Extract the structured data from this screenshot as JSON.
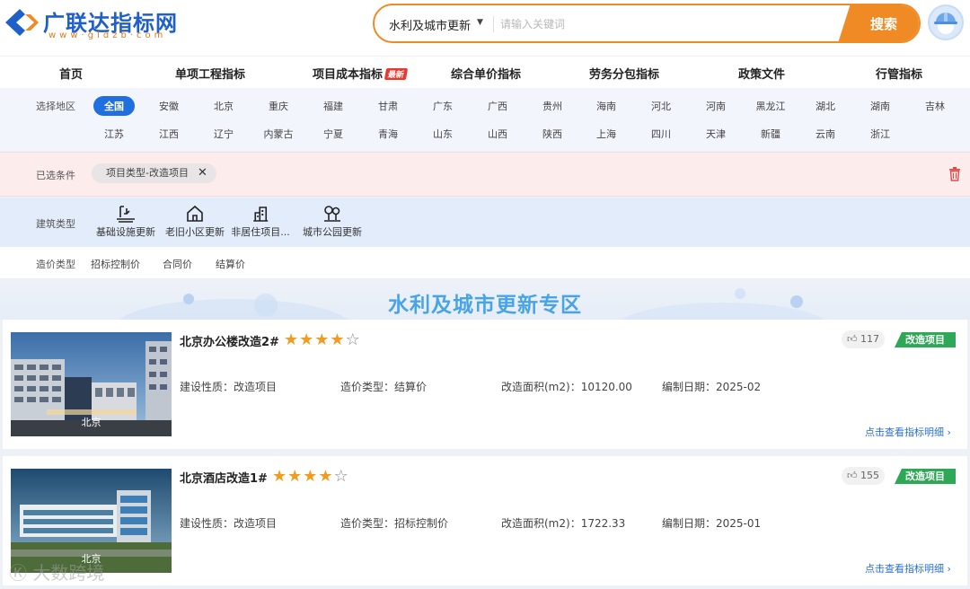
{
  "header": {
    "logo_text": "广联达指标网",
    "logo_sub": "www·gldzb·com",
    "search_category": "水利及城市更新",
    "search_placeholder": "请输入关键词",
    "search_button": "搜索"
  },
  "nav": [
    {
      "label": "首页"
    },
    {
      "label": "单项工程指标"
    },
    {
      "label": "项目成本指标",
      "badge": "最新"
    },
    {
      "label": "综合单价指标"
    },
    {
      "label": "劳务分包指标"
    },
    {
      "label": "政策文件"
    },
    {
      "label": "行管指标"
    }
  ],
  "region": {
    "label": "选择地区",
    "row1": [
      "全国",
      "安徽",
      "北京",
      "重庆",
      "福建",
      "甘肃",
      "广东",
      "广西",
      "贵州",
      "海南",
      "河北",
      "河南",
      "黑龙江",
      "湖北",
      "湖南",
      "吉林"
    ],
    "row2": [
      "江苏",
      "江西",
      "辽宁",
      "内蒙古",
      "宁夏",
      "青海",
      "山东",
      "山西",
      "陕西",
      "上海",
      "四川",
      "天津",
      "新疆",
      "云南",
      "浙江"
    ],
    "active": "全国"
  },
  "selected": {
    "label": "已选条件",
    "chip": "项目类型-改造项目"
  },
  "building": {
    "label": "建筑类型",
    "types": [
      {
        "label": "基础设施更新",
        "icon": "infrastructure-icon"
      },
      {
        "label": "老旧小区更新",
        "icon": "house-icon"
      },
      {
        "label": "非居住项目...",
        "icon": "building-icon"
      },
      {
        "label": "城市公园更新",
        "icon": "park-icon"
      }
    ]
  },
  "cost": {
    "label": "造价类型",
    "options": [
      "招标控制价",
      "合同价",
      "结算价"
    ]
  },
  "banner_title": "水利及城市更新专区",
  "cards": [
    {
      "title": "北京办公楼改造2#",
      "rating": 4,
      "image_label": "北京",
      "nature": "建设性质：改造项目",
      "cost_type": "造价类型：结算价",
      "area": "改造面积(m2)：10120.00",
      "date": "编制日期：2025-02",
      "likes": "117",
      "tag": "改造项目",
      "link": "点击查看指标明细"
    },
    {
      "title": "北京酒店改造1#",
      "rating": 4,
      "image_label": "北京",
      "nature": "建设性质：改造项目",
      "cost_type": "造价类型：招标控制价",
      "area": "改造面积(m2)：1722.33",
      "date": "编制日期：2025-01",
      "likes": "155",
      "tag": "改造项目",
      "link": "点击查看指标明细"
    }
  ],
  "watermark": "大数跨境",
  "colors": {
    "brand_blue": "#1f5fc9",
    "accent_orange": "#f08a24",
    "tag_green": "#2ea756",
    "link_blue": "#2a6fd6",
    "star": "#f39b1f"
  }
}
